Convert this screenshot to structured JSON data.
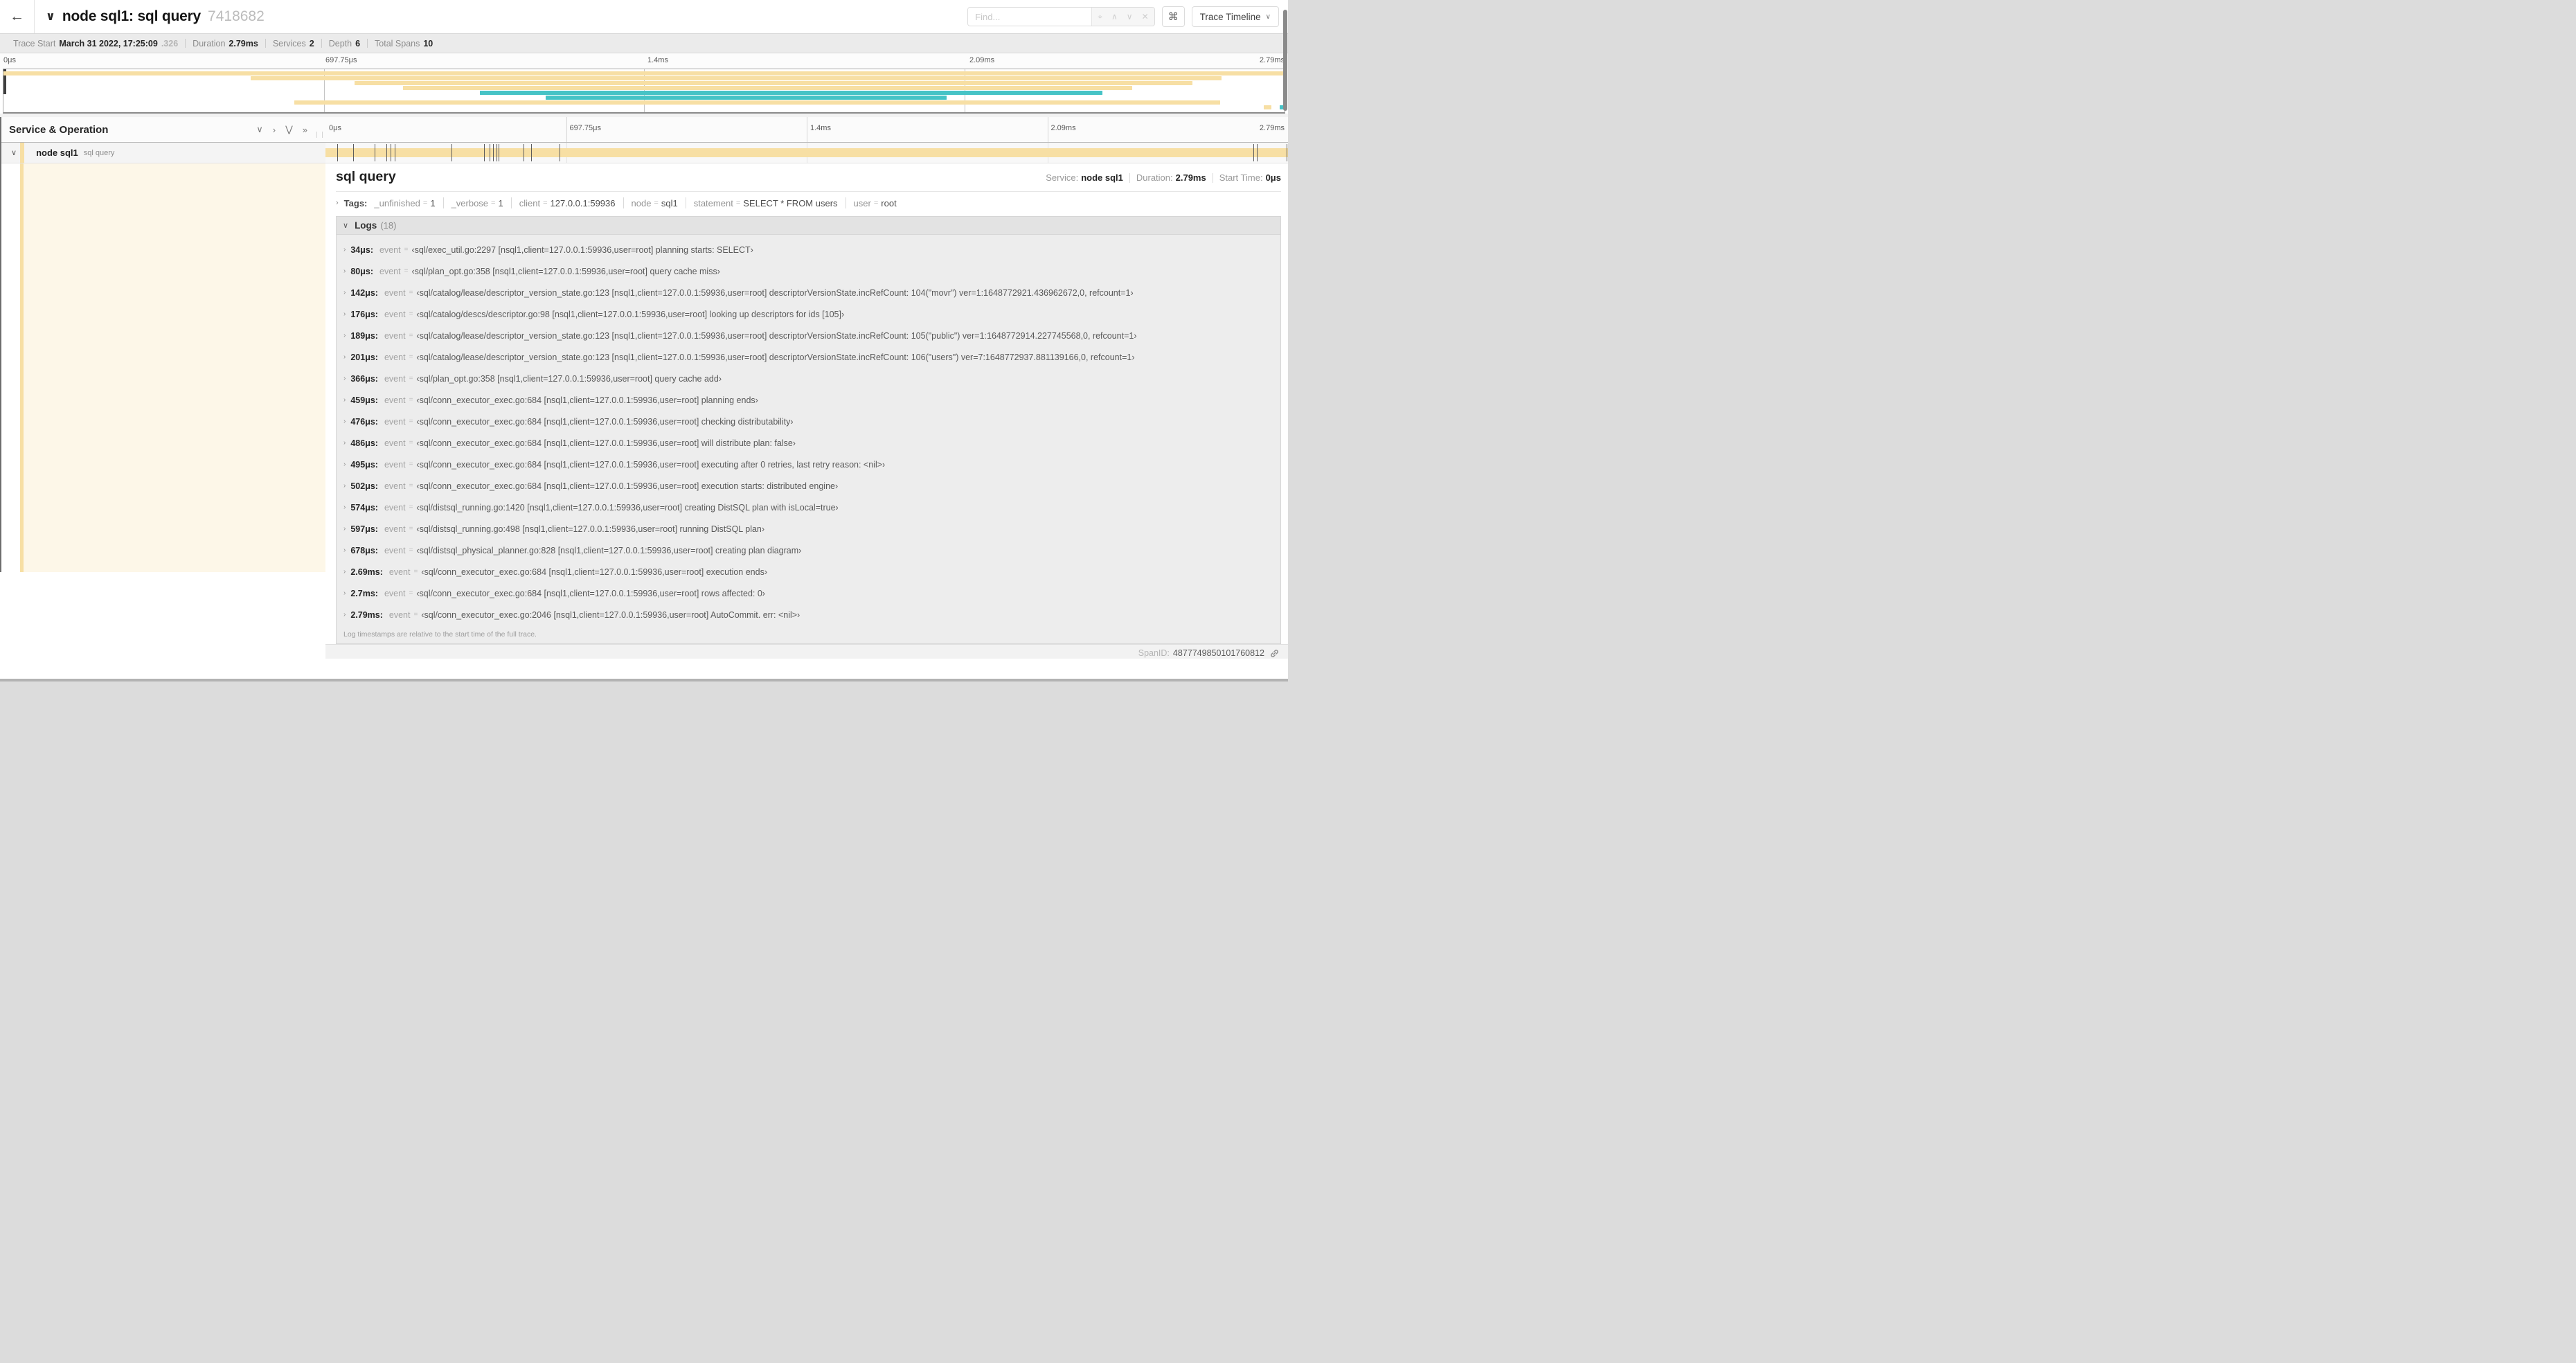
{
  "header": {
    "back_glyph": "←",
    "collapse_chevron": "∨",
    "title": "node sql1: sql query",
    "trace_id": "7418682",
    "find_placeholder": "Find...",
    "icons": {
      "target": "⌖",
      "prev": "∧",
      "next": "∨",
      "clear": "✕"
    },
    "shortcut_key": "⌘",
    "view_menu_label": "Trace Timeline",
    "view_menu_chevron": "∨"
  },
  "trace_info": {
    "items": [
      {
        "label": "Trace Start",
        "value": "March 31 2022, 17:25:09",
        "suffix": ".326"
      },
      {
        "label": "Duration",
        "value": "2.79ms"
      },
      {
        "label": "Services",
        "value": "2"
      },
      {
        "label": "Depth",
        "value": "6"
      },
      {
        "label": "Total Spans",
        "value": "10"
      }
    ]
  },
  "timeline": {
    "total_duration_us": 2790,
    "ruler_ticks": [
      {
        "label": "0μs",
        "pos": 0
      },
      {
        "label": "697.75μs",
        "pos": 0.25
      },
      {
        "label": "1.4ms",
        "pos": 0.5
      },
      {
        "label": "2.09ms",
        "pos": 0.75
      },
      {
        "label": "2.79ms",
        "pos": 1
      }
    ]
  },
  "colors": {
    "span_tan": "#f7dfa4",
    "span_teal": "#46c3c6",
    "expanded_row_bg": "#fdf7e8"
  },
  "minimap": {
    "spans": [
      {
        "row": 0,
        "start": 0.0,
        "end": 1.0,
        "color": "#f7dfa4"
      },
      {
        "row": 1,
        "start": 0.193,
        "end": 0.951,
        "color": "#f7dfa4"
      },
      {
        "row": 2,
        "start": 0.274,
        "end": 0.928,
        "color": "#f7dfa4"
      },
      {
        "row": 3,
        "start": 0.312,
        "end": 0.881,
        "color": "#f7dfa4"
      },
      {
        "row": 4,
        "start": 0.372,
        "end": 0.858,
        "color": "#46c3c6"
      },
      {
        "row": 5,
        "start": 0.423,
        "end": 0.736,
        "color": "#46c3c6"
      },
      {
        "row": 6,
        "start": 0.227,
        "end": 0.95,
        "color": "#f7dfa4"
      },
      {
        "row": 7,
        "start": 0.984,
        "end": 0.99,
        "color": "#f7dfa4"
      },
      {
        "row": 7,
        "start": 0.996,
        "end": 1.0,
        "color": "#46c3c6"
      }
    ]
  },
  "service_column": {
    "header": "Service & Operation",
    "collapse_icons": [
      "∨",
      "›",
      "⋁",
      "»"
    ]
  },
  "span_row": {
    "service": "node sql1",
    "operation": "sql query",
    "chevron": "∨",
    "color": "#f7dfa4"
  },
  "detail": {
    "title": "sql query",
    "stats": [
      {
        "label": "Service:",
        "value": "node sql1"
      },
      {
        "label": "Duration:",
        "value": "2.79ms"
      },
      {
        "label": "Start Time:",
        "value": "0μs"
      }
    ],
    "tags_label": "Tags:",
    "tags": [
      {
        "key": "_unfinished",
        "value": "1"
      },
      {
        "key": "_verbose",
        "value": "1"
      },
      {
        "key": "client",
        "value": "127.0.0.1:59936"
      },
      {
        "key": "node",
        "value": "sql1"
      },
      {
        "key": "statement",
        "value": "SELECT * FROM users"
      },
      {
        "key": "user",
        "value": "root"
      }
    ],
    "logs_label": "Logs",
    "logs_count": "(18)",
    "log_field": "event",
    "logs": [
      {
        "time": "34μs",
        "time_us": 34,
        "value": "‹sql/exec_util.go:2297 [nsql1,client=127.0.0.1:59936,user=root] planning starts: SELECT›"
      },
      {
        "time": "80μs",
        "time_us": 80,
        "value": "‹sql/plan_opt.go:358 [nsql1,client=127.0.0.1:59936,user=root] query cache miss›"
      },
      {
        "time": "142μs",
        "time_us": 142,
        "value": "‹sql/catalog/lease/descriptor_version_state.go:123 [nsql1,client=127.0.0.1:59936,user=root] descriptorVersionState.incRefCount: 104(\"movr\") ver=1:1648772921.436962672,0, refcount=1›"
      },
      {
        "time": "176μs",
        "time_us": 176,
        "value": "‹sql/catalog/descs/descriptor.go:98 [nsql1,client=127.0.0.1:59936,user=root] looking up descriptors for ids [105]›"
      },
      {
        "time": "189μs",
        "time_us": 189,
        "value": "‹sql/catalog/lease/descriptor_version_state.go:123 [nsql1,client=127.0.0.1:59936,user=root] descriptorVersionState.incRefCount: 105(\"public\") ver=1:1648772914.227745568,0, refcount=1›"
      },
      {
        "time": "201μs",
        "time_us": 201,
        "value": "‹sql/catalog/lease/descriptor_version_state.go:123 [nsql1,client=127.0.0.1:59936,user=root] descriptorVersionState.incRefCount: 106(\"users\") ver=7:1648772937.881139166,0, refcount=1›"
      },
      {
        "time": "366μs",
        "time_us": 366,
        "value": "‹sql/plan_opt.go:358 [nsql1,client=127.0.0.1:59936,user=root] query cache add›"
      },
      {
        "time": "459μs",
        "time_us": 459,
        "value": "‹sql/conn_executor_exec.go:684 [nsql1,client=127.0.0.1:59936,user=root] planning ends›"
      },
      {
        "time": "476μs",
        "time_us": 476,
        "value": "‹sql/conn_executor_exec.go:684 [nsql1,client=127.0.0.1:59936,user=root] checking distributability›"
      },
      {
        "time": "486μs",
        "time_us": 486,
        "value": "‹sql/conn_executor_exec.go:684 [nsql1,client=127.0.0.1:59936,user=root] will distribute plan: false›"
      },
      {
        "time": "495μs",
        "time_us": 495,
        "value": "‹sql/conn_executor_exec.go:684 [nsql1,client=127.0.0.1:59936,user=root] executing after 0 retries, last retry reason: <nil>›"
      },
      {
        "time": "502μs",
        "time_us": 502,
        "value": "‹sql/conn_executor_exec.go:684 [nsql1,client=127.0.0.1:59936,user=root] execution starts: distributed engine›"
      },
      {
        "time": "574μs",
        "time_us": 574,
        "value": "‹sql/distsql_running.go:1420 [nsql1,client=127.0.0.1:59936,user=root] creating DistSQL plan with isLocal=true›"
      },
      {
        "time": "597μs",
        "time_us": 597,
        "value": "‹sql/distsql_running.go:498 [nsql1,client=127.0.0.1:59936,user=root] running DistSQL plan›"
      },
      {
        "time": "678μs",
        "time_us": 678,
        "value": "‹sql/distsql_physical_planner.go:828 [nsql1,client=127.0.0.1:59936,user=root] creating plan diagram›"
      },
      {
        "time": "2.69ms",
        "time_us": 2690,
        "value": "‹sql/conn_executor_exec.go:684 [nsql1,client=127.0.0.1:59936,user=root] execution ends›"
      },
      {
        "time": "2.7ms",
        "time_us": 2700,
        "value": "‹sql/conn_executor_exec.go:684 [nsql1,client=127.0.0.1:59936,user=root] rows affected: 0›"
      },
      {
        "time": "2.79ms",
        "time_us": 2790,
        "value": "‹sql/conn_executor_exec.go:2046 [nsql1,client=127.0.0.1:59936,user=root] AutoCommit. err: <nil>›"
      }
    ],
    "footer": "Log timestamps are relative to the start time of the full trace.",
    "spanid_label": "SpanID:",
    "spanid_value": "4877749850101760812"
  }
}
